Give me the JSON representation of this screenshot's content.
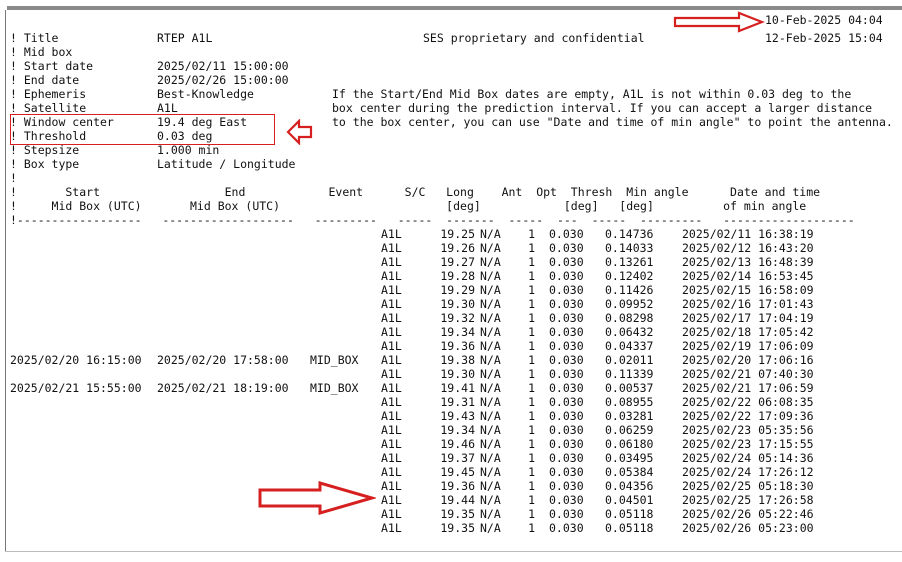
{
  "dates": {
    "first": "10-Feb-2025 04:04",
    "second": "12-Feb-2025 15:04"
  },
  "header": {
    "title_label": "! Title",
    "title_value": "RTEP A1L",
    "confidential": "SES proprietary and confidential",
    "midbox_label": "! Mid box",
    "start_label": "! Start date",
    "start_value": "2025/02/11 15:00:00",
    "end_label": "! End date",
    "end_value": "2025/02/26 15:00:00",
    "ephemeris_label": "! Ephemeris",
    "ephemeris_value": "Best-Knowledge",
    "satellite_label": "! Satellite",
    "satellite_value": "A1L",
    "window_label": "! Window center",
    "window_value": "19.4 deg East",
    "threshold_label": "! Threshold",
    "threshold_value": "0.03 deg",
    "stepsize_label": "! Stepsize",
    "stepsize_value": "1.000 min",
    "boxtype_label": "! Box type",
    "boxtype_value": "Latitude / Longitude",
    "blank": "!"
  },
  "note": {
    "line1": "If the Start/End Mid Box dates are empty, A1L is not within 0.03 deg to the",
    "line2": "box center during the prediction interval. If you can accept a larger distance",
    "line3": "to the box center, you can use \"Date and time of min angle\" to point the antenna."
  },
  "columns": {
    "line1": "!       Start                  End            Event      S/C   Long    Ant  Opt  Thresh  Min angle      Date and time",
    "line2": "!     Mid Box (UTC)       Mid Box (UTC)                        [deg]            [deg]   [deg]          of min angle",
    "line3": "!------------------   -------------------   ---------   -----  -------  -----  ---  -----  ---------   -------------------"
  },
  "rows": [
    {
      "start": "",
      "end": "",
      "event": "",
      "sc": "A1L",
      "long": "19.25",
      "ant": "N/A",
      "opt": "1",
      "thresh": "0.030",
      "min": "0.14736",
      "dt": "2025/02/11 16:38:19"
    },
    {
      "start": "",
      "end": "",
      "event": "",
      "sc": "A1L",
      "long": "19.26",
      "ant": "N/A",
      "opt": "1",
      "thresh": "0.030",
      "min": "0.14033",
      "dt": "2025/02/12 16:43:20"
    },
    {
      "start": "",
      "end": "",
      "event": "",
      "sc": "A1L",
      "long": "19.27",
      "ant": "N/A",
      "opt": "1",
      "thresh": "0.030",
      "min": "0.13261",
      "dt": "2025/02/13 16:48:39"
    },
    {
      "start": "",
      "end": "",
      "event": "",
      "sc": "A1L",
      "long": "19.28",
      "ant": "N/A",
      "opt": "1",
      "thresh": "0.030",
      "min": "0.12402",
      "dt": "2025/02/14 16:53:45"
    },
    {
      "start": "",
      "end": "",
      "event": "",
      "sc": "A1L",
      "long": "19.29",
      "ant": "N/A",
      "opt": "1",
      "thresh": "0.030",
      "min": "0.11426",
      "dt": "2025/02/15 16:58:09"
    },
    {
      "start": "",
      "end": "",
      "event": "",
      "sc": "A1L",
      "long": "19.30",
      "ant": "N/A",
      "opt": "1",
      "thresh": "0.030",
      "min": "0.09952",
      "dt": "2025/02/16 17:01:43"
    },
    {
      "start": "",
      "end": "",
      "event": "",
      "sc": "A1L",
      "long": "19.32",
      "ant": "N/A",
      "opt": "1",
      "thresh": "0.030",
      "min": "0.08298",
      "dt": "2025/02/17 17:04:19"
    },
    {
      "start": "",
      "end": "",
      "event": "",
      "sc": "A1L",
      "long": "19.34",
      "ant": "N/A",
      "opt": "1",
      "thresh": "0.030",
      "min": "0.06432",
      "dt": "2025/02/18 17:05:42"
    },
    {
      "start": "",
      "end": "",
      "event": "",
      "sc": "A1L",
      "long": "19.36",
      "ant": "N/A",
      "opt": "1",
      "thresh": "0.030",
      "min": "0.04337",
      "dt": "2025/02/19 17:06:09"
    },
    {
      "start": "2025/02/20 16:15:00",
      "end": "2025/02/20 17:58:00",
      "event": "MID_BOX",
      "sc": "A1L",
      "long": "19.38",
      "ant": "N/A",
      "opt": "1",
      "thresh": "0.030",
      "min": "0.02011",
      "dt": "2025/02/20 17:06:16"
    },
    {
      "start": "",
      "end": "",
      "event": "",
      "sc": "A1L",
      "long": "19.30",
      "ant": "N/A",
      "opt": "1",
      "thresh": "0.030",
      "min": "0.11339",
      "dt": "2025/02/21 07:40:30"
    },
    {
      "start": "2025/02/21 15:55:00",
      "end": "2025/02/21 18:19:00",
      "event": "MID_BOX",
      "sc": "A1L",
      "long": "19.41",
      "ant": "N/A",
      "opt": "1",
      "thresh": "0.030",
      "min": "0.00537",
      "dt": "2025/02/21 17:06:59"
    },
    {
      "start": "",
      "end": "",
      "event": "",
      "sc": "A1L",
      "long": "19.31",
      "ant": "N/A",
      "opt": "1",
      "thresh": "0.030",
      "min": "0.08955",
      "dt": "2025/02/22 06:08:35"
    },
    {
      "start": "",
      "end": "",
      "event": "",
      "sc": "A1L",
      "long": "19.43",
      "ant": "N/A",
      "opt": "1",
      "thresh": "0.030",
      "min": "0.03281",
      "dt": "2025/02/22 17:09:36"
    },
    {
      "start": "",
      "end": "",
      "event": "",
      "sc": "A1L",
      "long": "19.34",
      "ant": "N/A",
      "opt": "1",
      "thresh": "0.030",
      "min": "0.06259",
      "dt": "2025/02/23 05:35:56"
    },
    {
      "start": "",
      "end": "",
      "event": "",
      "sc": "A1L",
      "long": "19.46",
      "ant": "N/A",
      "opt": "1",
      "thresh": "0.030",
      "min": "0.06180",
      "dt": "2025/02/23 17:15:55"
    },
    {
      "start": "",
      "end": "",
      "event": "",
      "sc": "A1L",
      "long": "19.37",
      "ant": "N/A",
      "opt": "1",
      "thresh": "0.030",
      "min": "0.03495",
      "dt": "2025/02/24 05:14:36"
    },
    {
      "start": "",
      "end": "",
      "event": "",
      "sc": "A1L",
      "long": "19.45",
      "ant": "N/A",
      "opt": "1",
      "thresh": "0.030",
      "min": "0.05384",
      "dt": "2025/02/24 17:26:12"
    },
    {
      "start": "",
      "end": "",
      "event": "",
      "sc": "A1L",
      "long": "19.36",
      "ant": "N/A",
      "opt": "1",
      "thresh": "0.030",
      "min": "0.04356",
      "dt": "2025/02/25 05:18:30"
    },
    {
      "start": "",
      "end": "",
      "event": "",
      "sc": "A1L",
      "long": "19.44",
      "ant": "N/A",
      "opt": "1",
      "thresh": "0.030",
      "min": "0.04501",
      "dt": "2025/02/25 17:26:58"
    },
    {
      "start": "",
      "end": "",
      "event": "",
      "sc": "A1L",
      "long": "19.35",
      "ant": "N/A",
      "opt": "1",
      "thresh": "0.030",
      "min": "0.05118",
      "dt": "2025/02/26 05:22:46"
    },
    {
      "start": "",
      "end": "",
      "event": "",
      "sc": "A1L",
      "long": "19.35",
      "ant": "N/A",
      "opt": "1",
      "thresh": "0.030",
      "min": "0.05118",
      "dt": "2025/02/26 05:23:00"
    }
  ],
  "colors": {
    "annotation_red": "#d62020",
    "arrow_fill": "#ffffff"
  },
  "icons": [
    "right-arrow-icon",
    "left-arrow-icon"
  ]
}
